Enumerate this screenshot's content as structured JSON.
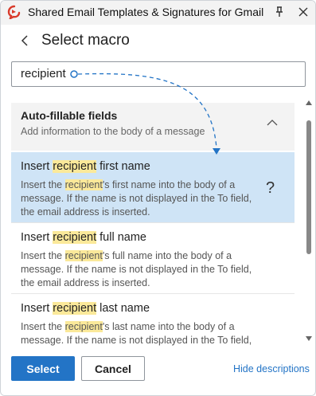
{
  "window": {
    "title": "Shared Email Templates & Signatures for Gmail",
    "icons": {
      "app": "app-logo-icon",
      "pin": "pin-icon",
      "close": "close-icon"
    }
  },
  "panel": {
    "title": "Select macro",
    "back_icon": "chevron-left-icon"
  },
  "search": {
    "value": "recipient"
  },
  "group": {
    "title": "Auto-fillable fields",
    "description": "Add information to the body of a message",
    "icon": "chevron-up-icon"
  },
  "items": [
    {
      "title_pre": "Insert ",
      "title_hl": "recipient",
      "title_post": " first name",
      "desc_pre": "Insert the ",
      "desc_hl": "recipient",
      "desc_post": "'s first name into the body of a message. If the name is not displayed in the To field, the email address is inserted.",
      "selected": true,
      "help": "?"
    },
    {
      "title_pre": "Insert ",
      "title_hl": "recipient",
      "title_post": " full name",
      "desc_pre": "Insert the ",
      "desc_hl": "recipient",
      "desc_post": "'s full name into the body of a message. If the name is not displayed in the To field, the email address is inserted.",
      "selected": false
    },
    {
      "title_pre": "Insert ",
      "title_hl": "recipient",
      "title_post": " last name",
      "desc_pre": "Insert the ",
      "desc_hl": "recipient",
      "desc_post": "'s last name into the body of a message. If the name is not displayed in the To field, the",
      "selected": false
    }
  ],
  "footer": {
    "select_label": "Select",
    "cancel_label": "Cancel",
    "hide_label": "Hide descriptions"
  },
  "colors": {
    "accent": "#2374c6",
    "selected_row": "#cfe4f6",
    "highlight": "#fbe99a"
  }
}
